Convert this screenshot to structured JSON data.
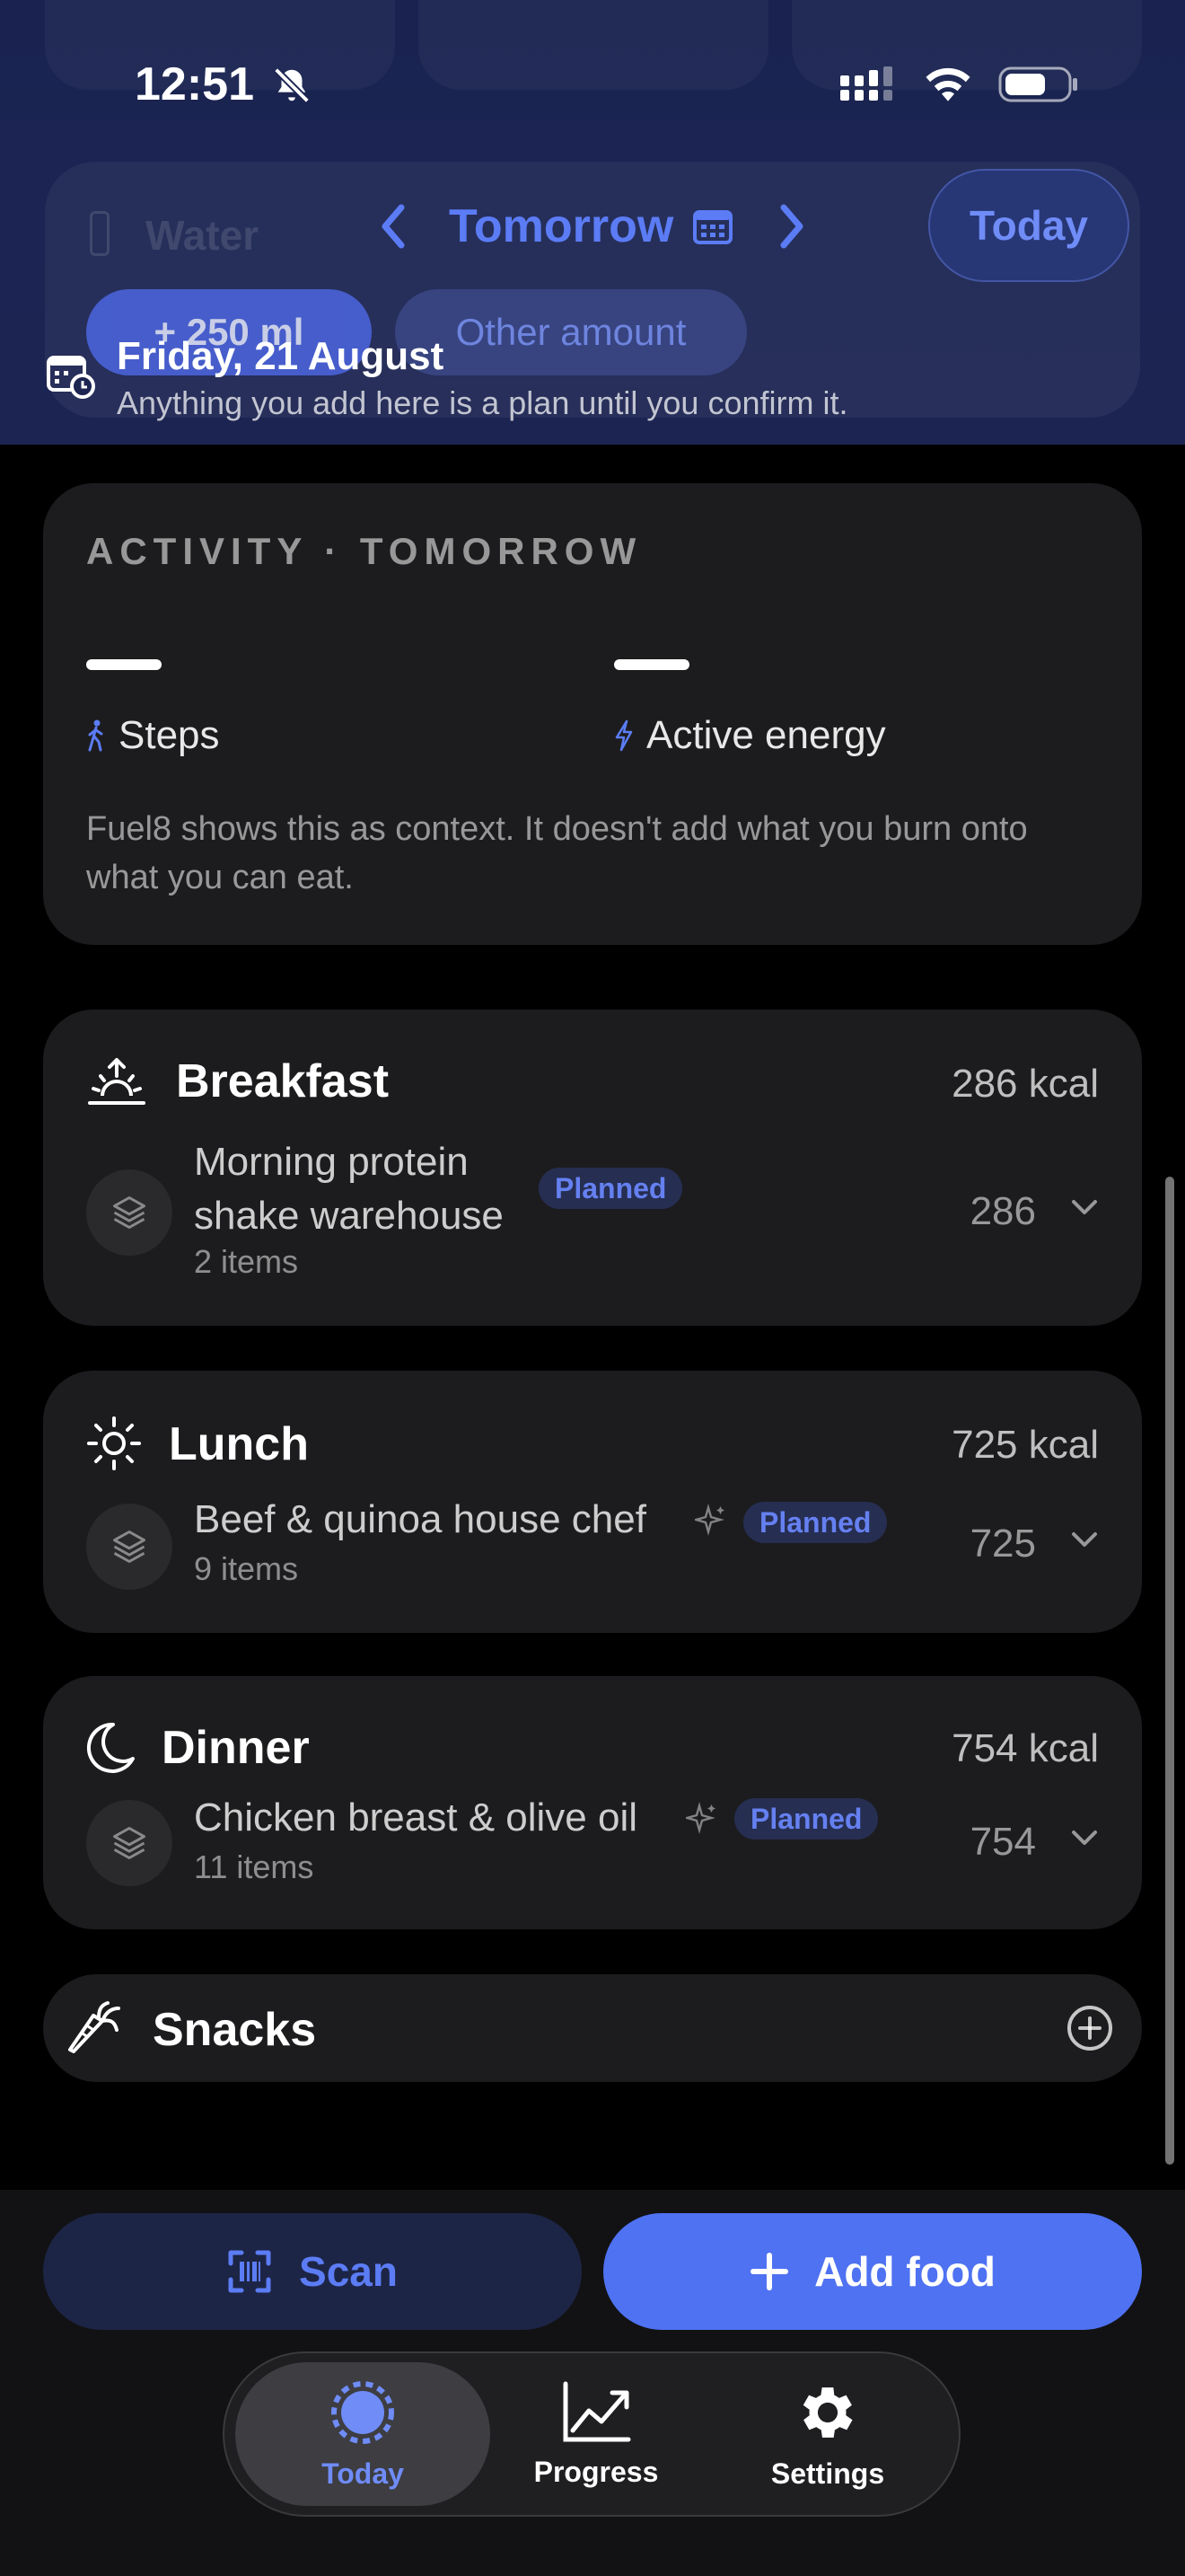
{
  "status": {
    "time": "12:51"
  },
  "header": {
    "prev_label": "previous day",
    "title": "Tomorrow",
    "today_button": "Today",
    "water_ghost": {
      "label": "Water",
      "quick_add": "+ 250 ml",
      "other": "Other amount"
    },
    "plan_date": "Friday, 21 August",
    "plan_note": "Anything you add here is a plan until you confirm it."
  },
  "activity": {
    "heading": "ACTIVITY · TOMORROW",
    "steps_label": "Steps",
    "energy_label": "Active energy",
    "description": "Fuel8 shows this as context. It doesn't add what you burn onto what you can eat."
  },
  "meals": {
    "breakfast": {
      "title": "Breakfast",
      "kcal": "286 kcal",
      "item": {
        "name": "Morning protein shake warehouse",
        "count": "2 items",
        "badge": "Planned",
        "kcal": "286"
      }
    },
    "lunch": {
      "title": "Lunch",
      "kcal": "725 kcal",
      "item": {
        "name": "Beef & quinoa house chef",
        "count": "9 items",
        "badge": "Planned",
        "kcal": "725"
      }
    },
    "dinner": {
      "title": "Dinner",
      "kcal": "754 kcal",
      "item": {
        "name": "Chicken breast & olive oil",
        "count": "11 items",
        "badge": "Planned",
        "kcal": "754"
      }
    },
    "snacks": {
      "title": "Snacks"
    }
  },
  "actions": {
    "scan": "Scan",
    "add_food": "Add food"
  },
  "tabs": [
    {
      "label": "Today"
    },
    {
      "label": "Progress"
    },
    {
      "label": "Settings"
    }
  ],
  "colors": {
    "accent": "#4f72f2",
    "badge_text": "#6580f0",
    "card": "#1c1c1e"
  }
}
